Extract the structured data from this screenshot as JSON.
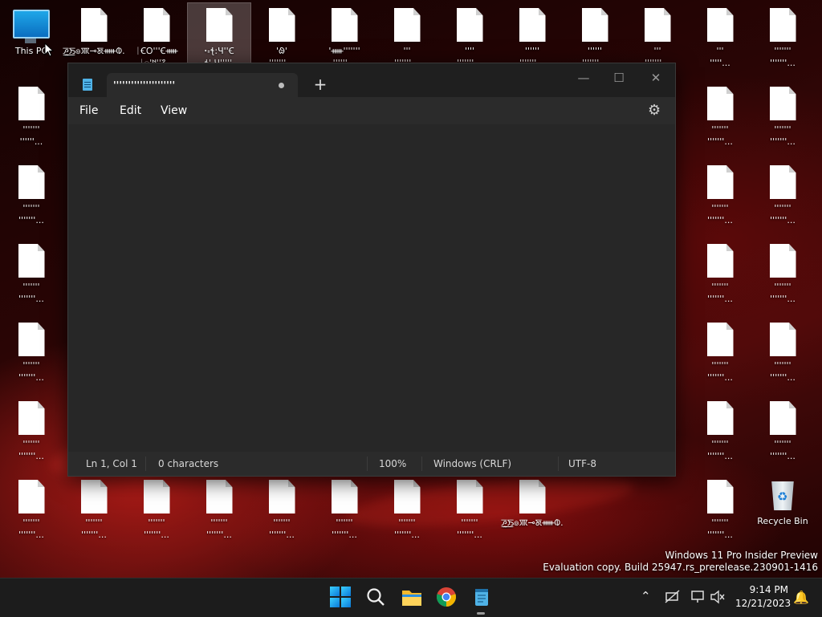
{
  "desktop": {
    "icons": [
      {
        "label": "This PC",
        "type": "pc"
      },
      {
        "label": "ꯍꯨ꯭ꯏ๏ꯄ⊸ꯗᚔᱵ...",
        "type": "file"
      },
      {
        "label": "ᛁꞒᱛꞌꞌꞌꞒᚔ\nᛁ꯭ꞌ᱑ꞌꞌ᱗...",
        "type": "file"
      },
      {
        "label": "ꞏ꞊ꞎ꞉ꞍꞌꞌꞒ\n꞊꞊ꞎꞌ Ɥꞌꞌꞌꞌꞌ...",
        "type": "file",
        "selected": true
      },
      {
        "label": "ꞌᱷꞌ\nꞌꞌꞌꞌꞌꞌꞌ...",
        "type": "file"
      },
      {
        "label": "ꞌᚔꞌꞌꞌꞌꞌꞌꞌ\nꞌꞌꞌꞌꞌꞌ...",
        "type": "file"
      },
      {
        "label": "ꞌꞌꞌ\nꞌꞌꞌꞌꞌꞌꞌ...",
        "type": "file"
      },
      {
        "label": "ꞌꞌꞌꞌ\nꞌꞌꞌꞌꞌꞌꞌ...",
        "type": "file"
      },
      {
        "label": "ꞌꞌꞌꞌꞌꞌ\nꞌꞌꞌꞌꞌꞌꞌ...",
        "type": "file"
      },
      {
        "label": "ꞌꞌꞌꞌꞌꞌ\nꞌꞌꞌꞌꞌꞌꞌ...",
        "type": "file"
      },
      {
        "label": "ꞌꞌꞌ\nꞌꞌꞌꞌꞌꞌꞌ...",
        "type": "file"
      },
      {
        "label": "ꞌꞌꞌ\nꞌꞌꞌꞌꞌ...",
        "type": "file"
      },
      {
        "label": "ꞌꞌꞌꞌꞌꞌꞌ\nꞌꞌꞌꞌꞌꞌꞌ...",
        "type": "file"
      },
      {
        "label": "ꞌꞌꞌꞌꞌꞌꞌ\nꞌꞌꞌꞌꞌꞌ...",
        "type": "file"
      },
      {
        "label": "ꞌꞌꞌꞌꞌꞌꞌ\nꞌꞌꞌꞌꞌꞌꞌ...",
        "type": "file"
      },
      {
        "label": "ꞌꞌꞌꞌꞌꞌꞌ\nꞌꞌꞌꞌꞌꞌꞌ...",
        "type": "file"
      },
      {
        "label": "ꞌꞌꞌꞌꞌꞌꞌ\nꞌꞌꞌꞌꞌꞌꞌ...",
        "type": "file"
      },
      {
        "label": "ꞌꞌꞌꞌꞌꞌꞌ\nꞌꞌꞌꞌꞌꞌꞌ...",
        "type": "file"
      },
      {
        "label": "ꞌꞌꞌꞌꞌꞌꞌ\nꞌꞌꞌꞌꞌꞌꞌ...",
        "type": "file"
      },
      {
        "label": "ꞌꞌꞌꞌꞌꞌꞌ\nꞌꞌꞌꞌꞌꞌꞌ...",
        "type": "file"
      },
      {
        "label": "ꞌꞌꞌꞌꞌꞌꞌ\nꞌꞌꞌꞌꞌꞌꞌ...",
        "type": "file"
      },
      {
        "label": "ꞌꞌꞌꞌꞌꞌꞌ\nꞌꞌꞌꞌꞌꞌꞌ...",
        "type": "file"
      },
      {
        "label": "ꞌꞌꞌꞌꞌꞌꞌ\nꞌꞌꞌꞌꞌꞌꞌ...",
        "type": "file"
      },
      {
        "label": "ꞌꞌꞌꞌꞌꞌꞌ\nꞌꞌꞌꞌꞌꞌꞌ...",
        "type": "file"
      },
      {
        "label": "ꞌꞌꞌꞌꞌꞌꞌ\nꞌꞌꞌꞌꞌꞌꞌ...",
        "type": "file"
      },
      {
        "label": "ꞌꞌꞌꞌꞌꞌꞌ\nꞌꞌꞌꞌꞌꞌꞌ...",
        "type": "file"
      },
      {
        "label": "ꞌꞌꞌꞌꞌꞌꞌ\nꞌꞌꞌꞌꞌꞌꞌ...",
        "type": "file"
      },
      {
        "label": "ꞌꞌꞌꞌꞌꞌꞌ\nꞌꞌꞌꞌꞌꞌꞌ...",
        "type": "file"
      },
      {
        "label": "ꞌꞌꞌꞌꞌꞌꞌ\nꞌꞌꞌꞌꞌꞌꞌ...",
        "type": "file"
      },
      {
        "label": "ꞌꞌꞌꞌꞌꞌꞌ\nꞌꞌꞌꞌꞌꞌꞌ...",
        "type": "file"
      },
      {
        "label": "ꞌꞌꞌꞌꞌꞌꞌ\nꞌꞌꞌꞌꞌꞌꞌ...",
        "type": "file"
      },
      {
        "label": "ꞌꞌꞌꞌꞌꞌꞌ\nꞌꞌꞌꞌꞌꞌꞌ...",
        "type": "file"
      },
      {
        "label": "ꞌꞌꞌꞌꞌꞌꞌ\nꞌꞌꞌꞌꞌꞌꞌ...",
        "type": "file"
      },
      {
        "label": "ꞌꞌꞌꞌꞌꞌꞌ\nꞌꞌꞌꞌꞌꞌꞌ...",
        "type": "file"
      },
      {
        "label": "ꞌꞌꞌꞌꞌꞌꞌ\nꞌꞌꞌꞌꞌꞌꞌ...",
        "type": "file"
      },
      {
        "label": "ꞌꞌꞌꞌꞌꞌꞌ\nꞌꞌꞌꞌꞌꞌꞌ...",
        "type": "file"
      },
      {
        "label": "ꞌꞌꞌꞌꞌꞌꞌ\nꞌꞌꞌꞌꞌꞌꞌ...",
        "type": "file"
      },
      {
        "label": "Recycle Bin",
        "type": "bin"
      }
    ]
  },
  "notepad": {
    "tab_title": "ꞌꞌꞌꞌꞌꞌꞌꞌꞌꞌꞌꞌꞌꞌꞌꞌꞌꞌꞌꞌꞌ",
    "new_tab": "+",
    "minimize": "—",
    "maximize": "☐",
    "close": "✕",
    "menu": {
      "file": "File",
      "edit": "Edit",
      "view": "View"
    },
    "settings_icon": "⚙",
    "content": "",
    "status": {
      "position": "Ln 1, Col 1",
      "characters": "0 characters",
      "zoom": "100%",
      "line_endings": "Windows (CRLF)",
      "encoding": "UTF-8"
    }
  },
  "watermark": {
    "line1": "Windows 11 Pro Insider Preview",
    "line2": "Evaluation copy. Build 25947.rs_prerelease.230901-1416"
  },
  "taskbar": {
    "clock_time": "9:14 PM",
    "clock_date": "12/21/2023",
    "tray_chevron": "⌃",
    "bell": "🔔"
  },
  "colors": {
    "accent": "#0a78d8",
    "notepad_icon": "#4fb2e6"
  }
}
